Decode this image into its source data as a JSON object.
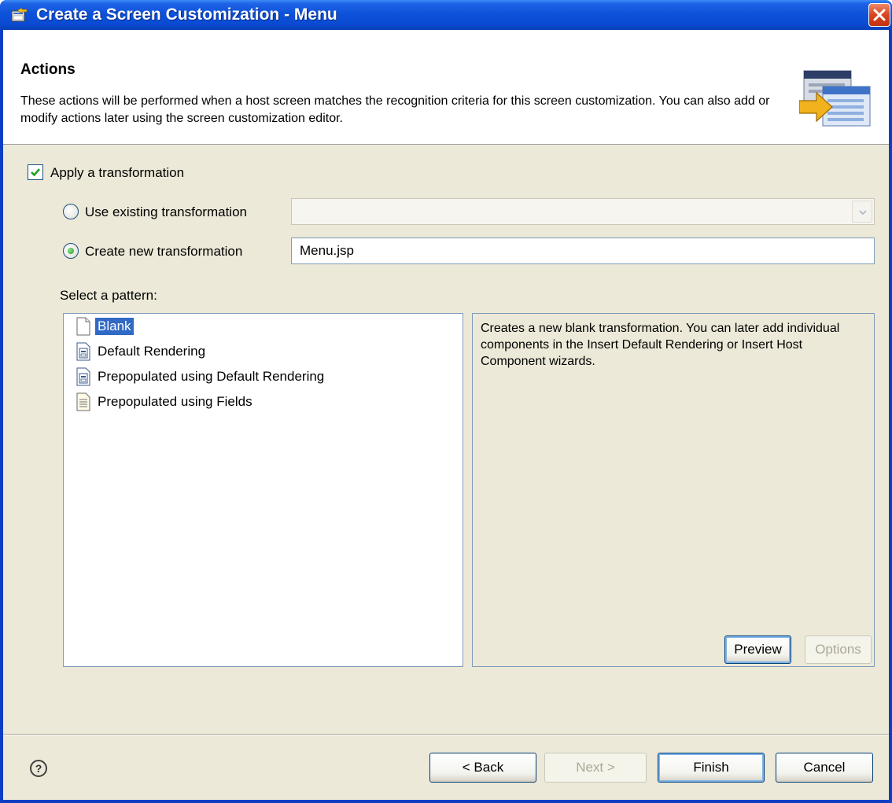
{
  "window": {
    "title": "Create a Screen Customization - Menu"
  },
  "banner": {
    "title": "Actions",
    "description": "These actions will be performed when a host screen matches the recognition criteria for this screen customization. You can also add or modify actions later using the screen customization editor."
  },
  "apply_transformation": {
    "label": "Apply a transformation",
    "checked": true
  },
  "options": {
    "use_existing_label": "Use existing transformation",
    "use_existing_selected": false,
    "existing_combo_value": "",
    "create_new_label": "Create new transformation",
    "create_new_selected": true,
    "new_name_value": "Menu.jsp"
  },
  "pattern": {
    "label": "Select a pattern:",
    "items": [
      {
        "label": "Blank",
        "icon": "blank-page-icon",
        "selected": true
      },
      {
        "label": "Default Rendering",
        "icon": "rendering-page-icon",
        "selected": false
      },
      {
        "label": "Prepopulated using Default Rendering",
        "icon": "rendering-page-icon",
        "selected": false
      },
      {
        "label": "Prepopulated using Fields",
        "icon": "text-page-icon",
        "selected": false
      }
    ],
    "description": "Creates a new blank transformation. You can later add individual components in the Insert Default Rendering or Insert Host Component wizards."
  },
  "pattern_buttons": {
    "preview_label": "Preview",
    "options_label": "Options"
  },
  "footer": {
    "help_glyph": "?",
    "back_label": "< Back",
    "next_label": "Next >",
    "finish_label": "Finish",
    "cancel_label": "Cancel"
  },
  "colors": {
    "titlebar": "#0a4bd3",
    "dialog_bg": "#ece9d8",
    "selection": "#316ac5",
    "close_button": "#d8441e"
  }
}
